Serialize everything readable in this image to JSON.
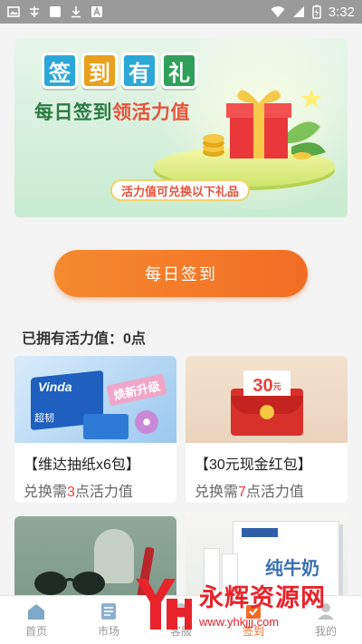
{
  "status_bar": {
    "time": "3:32"
  },
  "banner": {
    "title_chars": [
      "签",
      "到",
      "有",
      "礼"
    ],
    "subtitle_prefix": "每日签到",
    "subtitle_highlight": "领活力值",
    "ribbon": "活力值可兑换以下礼品"
  },
  "sign_in_button": "每日签到",
  "points_text": "已拥有活力值：0点",
  "products": [
    {
      "name": "【维达抽纸x6包】",
      "cost_prefix": "兑换需",
      "cost_num": "3",
      "cost_suffix": "点活力值",
      "promo": "焕新升级",
      "brand": "Vinda",
      "line": "超韧"
    },
    {
      "name": "【30元现金红包】",
      "cost_prefix": "兑换需",
      "cost_num": "7",
      "cost_suffix": "点活力值",
      "coupon": "30",
      "coupon_unit": "元"
    },
    {
      "name": ""
    },
    {
      "name": "",
      "milk_text": "纯牛奶"
    }
  ],
  "tabs": [
    {
      "label": "首页",
      "icon": "home-icon"
    },
    {
      "label": "市场",
      "icon": "market-icon"
    },
    {
      "label": "客服",
      "icon": "service-icon"
    },
    {
      "label": "签到",
      "icon": "checkin-icon"
    },
    {
      "label": "我的",
      "icon": "user-icon"
    }
  ],
  "watermark": {
    "big": "永辉资源网",
    "small": "www.yhkjjj.com"
  },
  "colors": {
    "accent": "#f26d24",
    "highlight": "#e8423a",
    "banner_green": "#2b7b42"
  }
}
